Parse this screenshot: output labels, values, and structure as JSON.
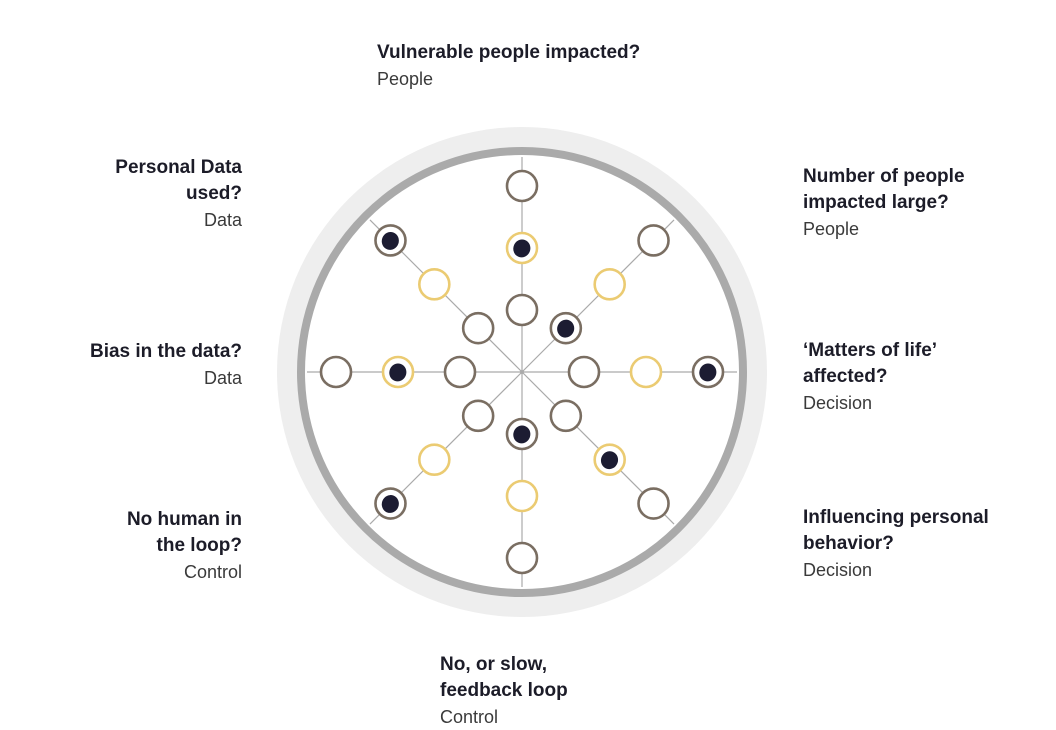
{
  "colors": {
    "outer_ring": "#eeeeee",
    "inner_ring": "#aaaaaa",
    "spoke": "#aaaaaa",
    "ring_brown": "#7a6e62",
    "ring_yellow": "#ebcb72",
    "dot_fill": "#1c1c32",
    "circle_bg": "#ffffff"
  },
  "axes": [
    {
      "id": "vulnerable-people",
      "question_lines": [
        "Vulnerable people impacted?"
      ],
      "category": "People"
    },
    {
      "id": "number-of-people",
      "question_lines": [
        "Number of people",
        "impacted large?"
      ],
      "category": "People"
    },
    {
      "id": "matters-of-life",
      "question_lines": [
        "‘Matters of life’",
        "affected?"
      ],
      "category": "Decision"
    },
    {
      "id": "influencing-behavior",
      "question_lines": [
        "Influencing personal",
        "behavior?"
      ],
      "category": "Decision"
    },
    {
      "id": "feedback-loop",
      "question_lines": [
        "No, or slow,",
        "feedback loop"
      ],
      "category": "Control"
    },
    {
      "id": "human-in-loop",
      "question_lines": [
        "No human in",
        "the loop?"
      ],
      "category": "Control"
    },
    {
      "id": "bias-in-data",
      "question_lines": [
        "Bias in the data?"
      ],
      "category": "Data"
    },
    {
      "id": "personal-data",
      "question_lines": [
        "Personal Data",
        "used?"
      ],
      "category": "Data"
    }
  ],
  "markers": [
    {
      "axis": "vulnerable-people",
      "levels": [
        "brown",
        "yellow",
        "brown"
      ],
      "selected_level": 2
    },
    {
      "axis": "number-of-people",
      "levels": [
        "brown",
        "yellow",
        "brown"
      ],
      "selected_level": 1
    },
    {
      "axis": "matters-of-life",
      "levels": [
        "brown",
        "yellow",
        "brown"
      ],
      "selected_level": 3
    },
    {
      "axis": "influencing-behavior",
      "levels": [
        "brown",
        "yellow",
        "brown"
      ],
      "selected_level": 2
    },
    {
      "axis": "feedback-loop",
      "levels": [
        "brown",
        "yellow",
        "brown"
      ],
      "selected_level": 1
    },
    {
      "axis": "human-in-loop",
      "levels": [
        "brown",
        "yellow",
        "brown"
      ],
      "selected_level": 3
    },
    {
      "axis": "bias-in-data",
      "levels": [
        "brown",
        "yellow",
        "brown"
      ],
      "selected_level": 2
    },
    {
      "axis": "personal-data",
      "levels": [
        "brown",
        "yellow",
        "brown"
      ],
      "selected_level": 3
    }
  ]
}
